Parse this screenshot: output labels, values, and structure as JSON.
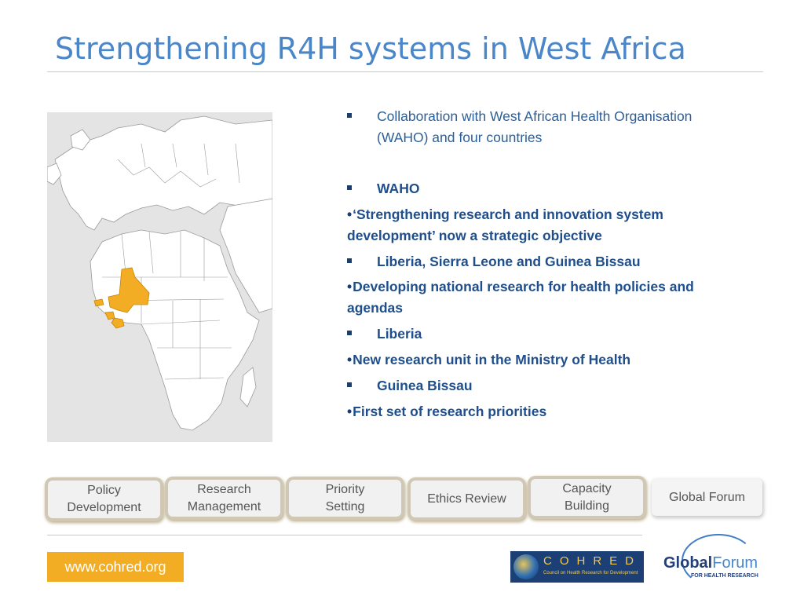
{
  "slide": {
    "title": "Strengthening R4H systems in West Africa"
  },
  "bullets": [
    {
      "kind": "square",
      "text": "Collaboration with West African Health Organisation (WAHO) and four countries",
      "bold": false
    },
    {
      "kind": "square",
      "text": "WAHO",
      "bold": true
    },
    {
      "kind": "dot",
      "text": "‘Strengthening research and innovation system development’ now a strategic objective",
      "bold": true
    },
    {
      "kind": "square",
      "text": "Liberia, Sierra Leone and Guinea Bissau",
      "bold": true
    },
    {
      "kind": "dot",
      "text": "Developing national research for health policies and agendas",
      "bold": true
    },
    {
      "kind": "square",
      "text": "Liberia",
      "bold": true
    },
    {
      "kind": "dot",
      "text": "New research unit in the Ministry of Health",
      "bold": true
    },
    {
      "kind": "square",
      "text": "Guinea Bissau",
      "bold": true
    },
    {
      "kind": "dot",
      "text": "First set of research priorities",
      "bold": true
    }
  ],
  "tabs": [
    {
      "label": "Policy\nDevelopment"
    },
    {
      "label": "Research\nManagement"
    },
    {
      "label": "Priority\nSetting"
    },
    {
      "label": "Ethics Review"
    },
    {
      "label": "Capacity\nBuilding"
    },
    {
      "label": "Global Forum"
    }
  ],
  "footer": {
    "url": "www.cohred.org",
    "cohred_name": "COHRED",
    "cohred_sub": "Council on Health Research for Development",
    "gf_part1": "Global",
    "gf_part2": "Forum",
    "gf_sub": "FOR HEALTH RESEARCH"
  },
  "colors": {
    "title": "#4a86c8",
    "highlight_countries": "#f2ad24",
    "accent_line": "#f3c84b"
  }
}
